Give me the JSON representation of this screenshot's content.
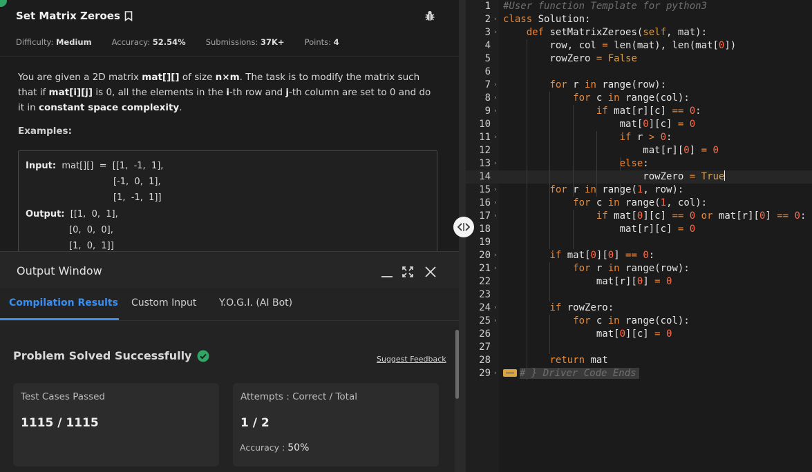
{
  "problem": {
    "title": "Set Matrix Zeroes",
    "meta": [
      {
        "label": "Difficulty:",
        "value": "Medium"
      },
      {
        "label": "Accuracy:",
        "value": "52.54%"
      },
      {
        "label": "Submissions:",
        "value": "37K+"
      },
      {
        "label": "Points:",
        "value": "4"
      }
    ],
    "description": {
      "t1": "You are given a 2D matrix ",
      "b1": "mat[][]",
      "t2": " of size ",
      "b2": "n×m",
      "t3": ". The task is to modify the matrix such that if ",
      "b3": "mat[i][j]",
      "t4": " is 0, all the elements in the ",
      "b4": "i",
      "t5": "-th row and ",
      "b5": "j",
      "t6": "-th column are set to 0 and do it in ",
      "b6": "constant space complexity",
      "t7": "."
    },
    "examples_label": "Examples:",
    "example": {
      "input_label": "Input:",
      "input_l1": "mat[][]  =  [[1,  -1,  1],",
      "input_l2": "[-1,  0,  1],",
      "input_l3": "[1,  -1,  1]]",
      "output_label": "Output:",
      "output_l1": "[[1,  0,  1],",
      "output_l2": "[0,  0,  0],",
      "output_l3": "[1,  0,  1]]"
    }
  },
  "output_window": {
    "title": "Output Window",
    "tabs": [
      "Compilation Results",
      "Custom Input",
      "Y.O.G.I. (AI Bot)"
    ],
    "status": "Problem Solved Successfully",
    "feedback": "Suggest Feedback",
    "cards": {
      "tests_label": "Test Cases Passed",
      "tests_value": "1115 / 1115",
      "attempts_label": "Attempts : Correct / Total",
      "attempts_value": "1 / 2",
      "accuracy_label": "Accuracy :",
      "accuracy_value": "50%"
    }
  },
  "editor": {
    "active_line": 14,
    "lines": [
      "#User function Template for python3",
      "class Solution:",
      "    def setMatrixZeroes(self, mat):",
      "        row, col = len(mat), len(mat[0])",
      "        rowZero = False",
      "",
      "        for r in range(row):",
      "            for c in range(col):",
      "                if mat[r][c] == 0:",
      "                    mat[0][c] = 0",
      "                    if r > 0:",
      "                        mat[r][0] = 0",
      "                    else:",
      "                        rowZero = True",
      "        for r in range(1, row):",
      "            for c in range(1, col):",
      "                if mat[0][c] == 0 or mat[r][0] == 0:",
      "                    mat[r][c] = 0",
      "",
      "        if mat[0][0] == 0:",
      "            for r in range(row):",
      "                mat[r][0] = 0",
      "",
      "        if rowZero:",
      "            for c in range(col):",
      "                mat[0][c] = 0",
      "",
      "        return mat",
      "# } Driver Code Ends"
    ],
    "fold_lines": [
      2,
      3,
      7,
      8,
      9,
      11,
      13,
      15,
      16,
      17,
      20,
      21,
      24,
      25,
      29
    ]
  },
  "colors": {
    "accent": "#3b8ef0",
    "success": "#2fa566",
    "keyword": "#e98a3a",
    "number": "#ff6b4a",
    "comment": "#6f6f6f"
  }
}
